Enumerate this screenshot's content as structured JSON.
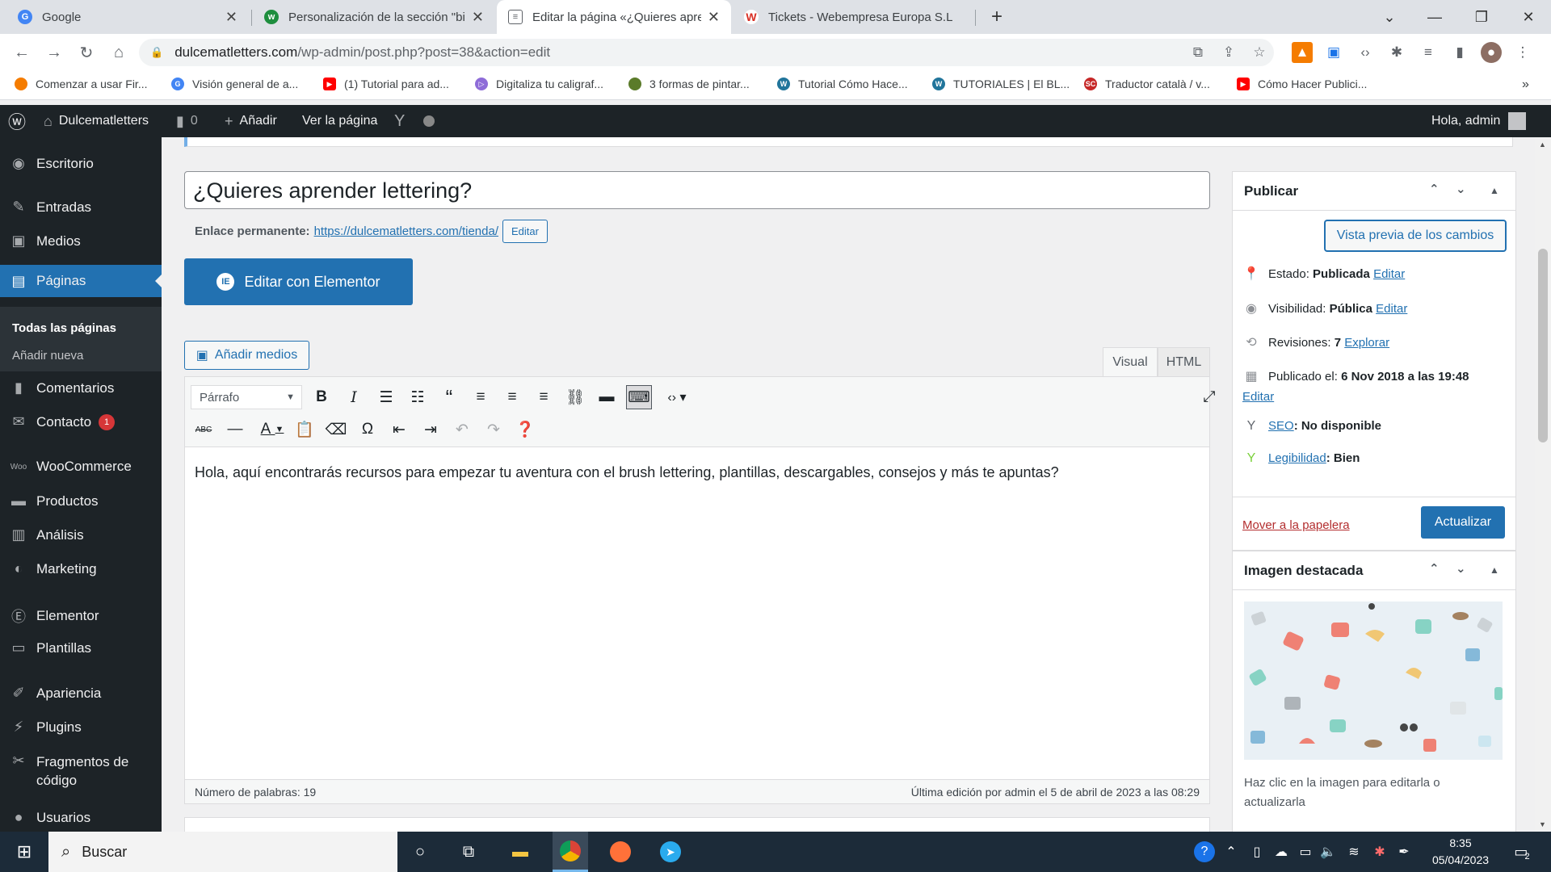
{
  "tabs": [
    {
      "title": "Google",
      "icon": "G",
      "color": "#4285f4"
    },
    {
      "title": "Personalización de la sección \"bie",
      "icon": "W",
      "color": "#1e8e3e"
    },
    {
      "title": "Editar la página «¿Quieres aprend",
      "icon": "≡",
      "color": "#5f6368"
    },
    {
      "title": "Tickets - Webempresa Europa S.L",
      "icon": "W",
      "color": "#d93025"
    }
  ],
  "address": {
    "host": "dulcematletters.com",
    "path": "/wp-admin/post.php?post=38&action=edit"
  },
  "bookmarks": [
    {
      "label": "Comenzar a usar Fir...",
      "color": "#f57c00"
    },
    {
      "label": "Visión general de a...",
      "color": "#4285f4"
    },
    {
      "label": "(1) Tutorial para ad...",
      "color": "#ff0000"
    },
    {
      "label": "Digitaliza tu caligraf...",
      "color": "#8e6cd8"
    },
    {
      "label": "3 formas de pintar...",
      "color": "#5b7b2a"
    },
    {
      "label": "Tutorial Cómo Hace...",
      "color": "#21759b"
    },
    {
      "label": "TUTORIALES | El BL...",
      "color": "#21759b"
    },
    {
      "label": "Traductor català / v...",
      "color": "#c62828"
    },
    {
      "label": "Cómo Hacer Publici...",
      "color": "#ff0000"
    }
  ],
  "adminbar": {
    "site": "Dulcematletters",
    "comments": "0",
    "add": "Añadir",
    "view": "Ver la página",
    "greeting": "Hola, admin"
  },
  "sidebar": {
    "items": [
      {
        "label": "Escritorio"
      },
      {
        "label": "Entradas"
      },
      {
        "label": "Medios"
      },
      {
        "label": "Páginas"
      },
      {
        "label": "Comentarios"
      },
      {
        "label": "Contacto"
      },
      {
        "label": "WooCommerce"
      },
      {
        "label": "Productos"
      },
      {
        "label": "Análisis"
      },
      {
        "label": "Marketing"
      },
      {
        "label": "Elementor"
      },
      {
        "label": "Plantillas"
      },
      {
        "label": "Apariencia"
      },
      {
        "label": "Plugins"
      },
      {
        "label": "Fragmentos de código"
      },
      {
        "label": "Usuarios"
      }
    ],
    "submenu": [
      "Todas las páginas",
      "Añadir nueva"
    ],
    "contact_badge": "1"
  },
  "editor": {
    "title": "¿Quieres aprender lettering?",
    "permalink_label": "Enlace permanente:",
    "permalink_url": "https://dulcematletters.com/tienda/",
    "permalink_edit": "Editar",
    "elementor_button": "Editar con Elementor",
    "add_media": "Añadir medios",
    "tab_visual": "Visual",
    "tab_html": "HTML",
    "format": "Párrafo",
    "content": "Hola, aquí encontrarás recursos para empezar tu aventura con el brush lettering, plantillas, descargables,  consejos  y más  te apuntas?",
    "word_count": "Número de palabras: 19",
    "last_edit": "Última edición por admin el 5 de abril de 2023 a las 08:29"
  },
  "publish": {
    "title": "Publicar",
    "preview": "Vista previa de los cambios",
    "status_label": "Estado:",
    "status_value": "Publicada",
    "edit": "Editar",
    "visibility_label": "Visibilidad:",
    "visibility_value": "Pública",
    "revisions_label": "Revisiones:",
    "revisions_value": "7",
    "explore": "Explorar",
    "published_label": "Publicado el:",
    "published_value": "6 Nov 2018 a las 19:48",
    "seo_label": "SEO",
    "seo_value": ": No disponible",
    "readability_label": "Legibilidad",
    "readability_value": ": Bien",
    "trash": "Mover a la papelera",
    "update": "Actualizar"
  },
  "featured": {
    "title": "Imagen destacada",
    "caption": "Haz clic en la imagen para editarla o actualizarla"
  },
  "taskbar": {
    "search": "Buscar",
    "time": "8:35",
    "date": "05/04/2023",
    "notif": "2"
  }
}
